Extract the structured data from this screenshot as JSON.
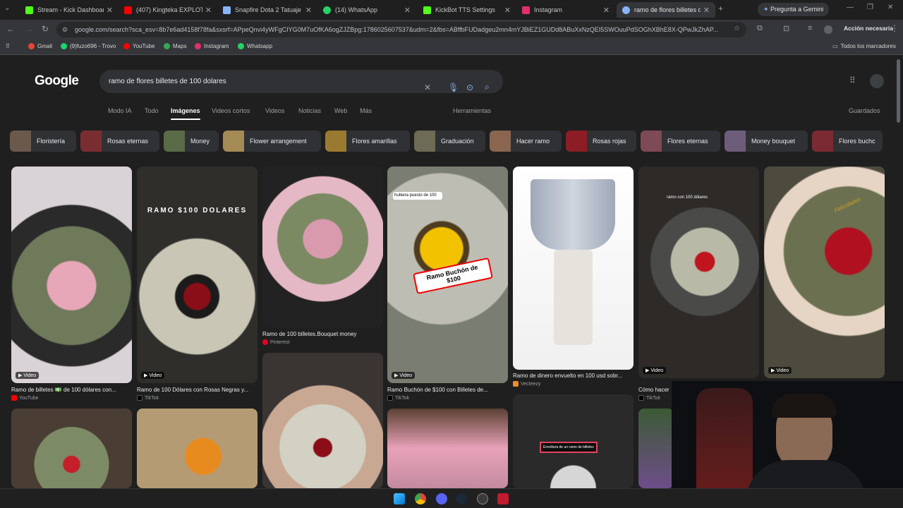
{
  "browser": {
    "tabs": [
      {
        "title": "Stream - Kick Dashboard",
        "color": "#53fc18"
      },
      {
        "title": "(407) Kingteka EXPLOTA c",
        "color": "#ff0000"
      },
      {
        "title": "Snapfire Dota 2 Tatuaje Ac",
        "color": "#8ab4f8"
      },
      {
        "title": "(14) WhatsApp",
        "color": "#25d366"
      },
      {
        "title": "KickBot TTS Settings",
        "color": "#53fc18"
      },
      {
        "title": "Instagram",
        "color": "#e1306c"
      },
      {
        "title": "ramo de flores billetes de",
        "color": "#8ab4f8"
      }
    ],
    "gemini_button": "Pregunta a Gemini",
    "url": "google.com/search?sca_esv=8b7e6ad4158f78fa&sxsrf=APpeQnvi4yWFgCIYG0M7uOfKA6ogZJZBpg:1786025607537&udm=2&fbs=ABffbFUDadgeu2mn4mYJBiEZ1GUDd8ABuXxNzQEI5SWOuuPdSOGhXBhE8X-QPwJkZhAP...",
    "action_needed": "Acción necesaria",
    "bookmarks": [
      "Gmail",
      "(9)fuzo696 - Trovo",
      "YouTube",
      "Maps",
      "Instagram",
      "Whatsapp"
    ],
    "all_bookmarks": "Todos los marcadores"
  },
  "google": {
    "logo": "Google",
    "query": "ramo de flores billetes de 100 dolares",
    "nav": [
      "Modo IA",
      "Todo",
      "Imágenes",
      "Videos cortos",
      "Videos",
      "Noticias",
      "Web",
      "Más"
    ],
    "tools": "Herramientas",
    "saved": "Guardados",
    "chips": [
      "Floristería",
      "Rosas eternas",
      "Money",
      "Flower arrangement",
      "Flores amarillas",
      "Graduación",
      "Hacer ramo",
      "Rosas rojas",
      "Flores eternas",
      "Money bouquet",
      "Flores buchc"
    ],
    "results": [
      {
        "caption": "Ramo de billetes 💵 de 100 dólares con...",
        "source": "YouTube",
        "badge": "Video"
      },
      {
        "caption": "Ramo de 100 Dólares con Rosas Negras y...",
        "source": "TikTok",
        "badge": "Video",
        "overlay": "RAMO $100 DOLARES"
      },
      {
        "caption": "Ramo de 100 billetes.Bouquet money",
        "source": "Pinterest",
        "badge": ""
      },
      {
        "caption": "Ramo Buchón de $100 con Billetes de...",
        "source": "TikTok",
        "badge": "Video",
        "overlay": "Ramo Buchón de $100",
        "note": "hubiera puesto de 100"
      },
      {
        "caption": "Ramo de dinero envuelto en 100 usd sobr...",
        "source": "Vecteezy",
        "badge": ""
      },
      {
        "caption": "Cómo hacer",
        "source": "TikTok",
        "badge": "Video",
        "overlay": "ramo con 100 dólares"
      },
      {
        "caption": "",
        "source": "",
        "badge": "Video",
        "overlay": "Felicidades"
      },
      {
        "caption": "",
        "source": "",
        "badge": "",
        "overlay": "Envoltura de un ramo de billetes"
      }
    ]
  }
}
